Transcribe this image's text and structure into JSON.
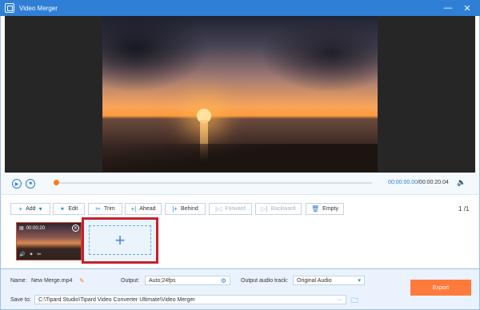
{
  "window": {
    "title": "Video Merger",
    "minimize": "—",
    "close": "✕"
  },
  "player": {
    "current_time": "00:00:00.00",
    "total_time": "/00:00:20.04",
    "progress": 0.0
  },
  "toolbar": {
    "add_label": "Add",
    "edit_label": "Edit",
    "trim_label": "Trim",
    "ahead_label": "Ahead",
    "behind_label": "Behind",
    "forward_label": "Forward",
    "backward_label": "Backward",
    "empty_label": "Empty",
    "page_current": "1",
    "page_total": "/1"
  },
  "clips": [
    {
      "duration": "00:00:20"
    }
  ],
  "settings": {
    "name_label": "Name:",
    "name_value": "New Merge.mp4",
    "output_label": "Output:",
    "output_value": "Auto;24fps",
    "audio_label": "Output audio track:",
    "audio_value": "Original Audio",
    "save_label": "Save to:",
    "save_value": "C:\\Tipard Studio\\Tipard Video Converter Ultimate\\Video Merger",
    "browse_label": "···",
    "export_label": "Export"
  },
  "colors": {
    "accent": "#2f7fd6",
    "export": "#ff7a3d",
    "highlight": "#c81f2a"
  }
}
